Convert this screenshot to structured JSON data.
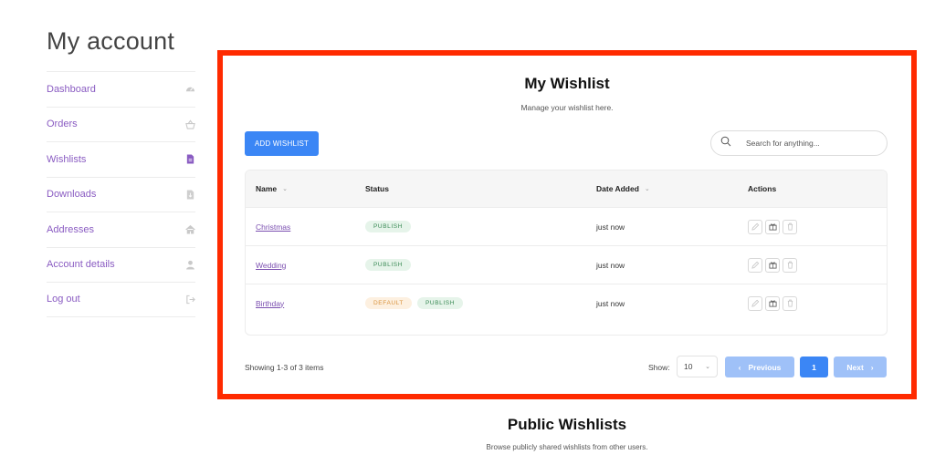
{
  "account": {
    "title": "My account"
  },
  "sidebar": {
    "items": [
      {
        "label": "Dashboard",
        "icon": "dashboard-icon"
      },
      {
        "label": "Orders",
        "icon": "basket-icon"
      },
      {
        "label": "Wishlists",
        "icon": "file-icon"
      },
      {
        "label": "Downloads",
        "icon": "file-download-icon"
      },
      {
        "label": "Addresses",
        "icon": "home-icon"
      },
      {
        "label": "Account details",
        "icon": "user-icon"
      },
      {
        "label": "Log out",
        "icon": "logout-icon"
      }
    ]
  },
  "wishlist": {
    "title": "My Wishlist",
    "subtitle": "Manage your wishlist here.",
    "add_button": "ADD WISHLIST",
    "search_placeholder": "Search for anything...",
    "columns": {
      "name": "Name",
      "status": "Status",
      "date": "Date Added",
      "actions": "Actions"
    },
    "rows": [
      {
        "name": "Christmas",
        "badges": [
          "PUBLISH"
        ],
        "date": "just now"
      },
      {
        "name": "Wedding",
        "badges": [
          "PUBLISH"
        ],
        "date": "just now"
      },
      {
        "name": "Birthday",
        "badges": [
          "DEFAULT",
          "PUBLISH"
        ],
        "date": "just now"
      }
    ],
    "footer": {
      "showing": "Showing 1-3 of 3 items",
      "show_label": "Show:",
      "per_page": "10",
      "prev": "Previous",
      "page": "1",
      "next": "Next"
    }
  },
  "public": {
    "title": "Public Wishlists",
    "subtitle": "Browse publicly shared wishlists from other users."
  },
  "colors": {
    "accent": "#3b86f5",
    "link": "#8a5cc2",
    "highlight": "#ff2a00",
    "publish": "#3a8a55",
    "default": "#d9923c"
  }
}
